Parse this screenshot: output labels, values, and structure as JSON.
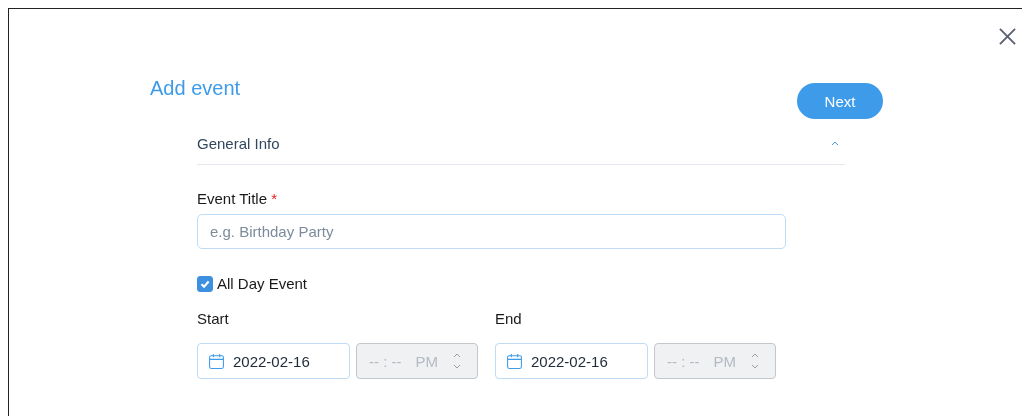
{
  "dialog": {
    "title": "Add event",
    "next_button": "Next"
  },
  "section": {
    "title": "General Info",
    "expanded": true
  },
  "event_title": {
    "label": "Event Title",
    "required_mark": "*",
    "placeholder": "e.g. Birthday Party"
  },
  "all_day": {
    "label": "All Day Event",
    "checked": true
  },
  "ranges": [
    {
      "label": "Start",
      "date": "2022-02-16",
      "time": "-- : --",
      "period": "PM",
      "time_disabled": true
    },
    {
      "label": "End",
      "date": "2022-02-16",
      "time": "-- : --",
      "period": "PM",
      "time_disabled": true
    }
  ]
}
